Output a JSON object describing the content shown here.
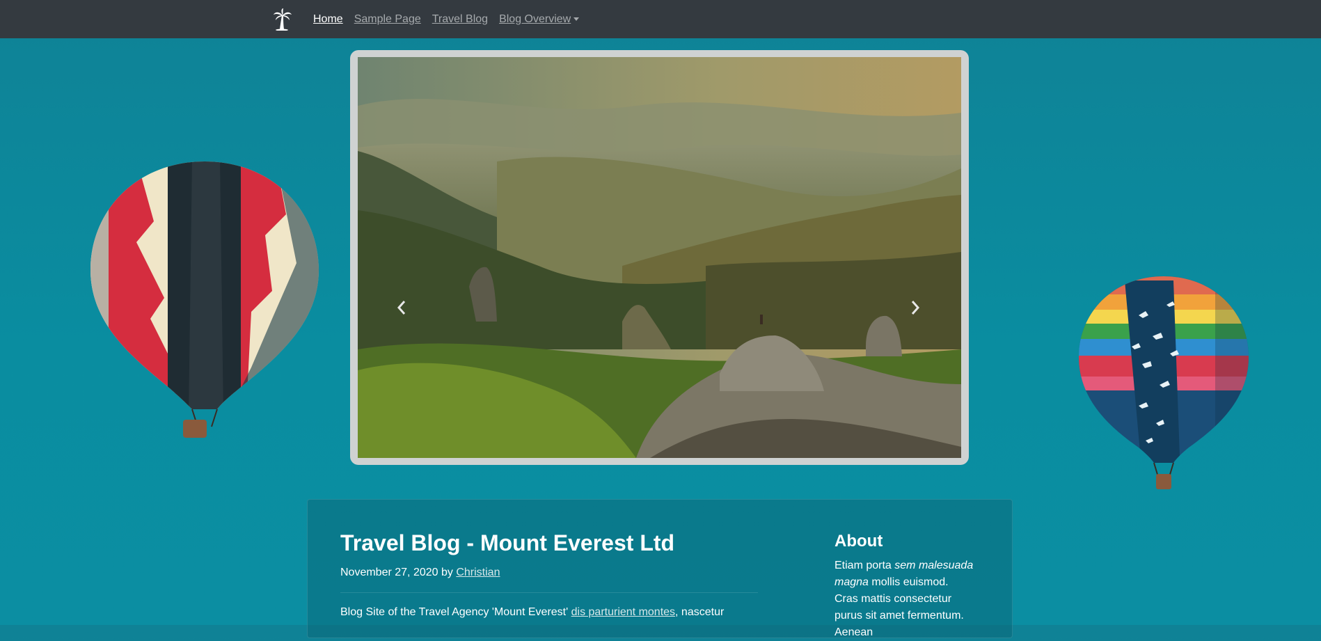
{
  "nav": {
    "brand_icon": "palm-tree-icon",
    "items": [
      {
        "label": "Home",
        "active": true
      },
      {
        "label": "Sample Page",
        "active": false
      },
      {
        "label": "Travel Blog",
        "active": false
      },
      {
        "label": "Blog Overview",
        "active": false,
        "dropdown": true
      }
    ]
  },
  "carousel": {
    "prev_icon": "chevron-left-icon",
    "next_icon": "chevron-right-icon"
  },
  "post": {
    "title": "Travel Blog - Mount Everest Ltd",
    "date": "November 27, 2020",
    "by": "by",
    "author": "Christian",
    "body_prefix": "Blog Site of the Travel Agency 'Mount Everest'",
    "body_link": "dis parturient montes",
    "body_suffix": ", nascetur"
  },
  "sidebar": {
    "about_title": "About",
    "about_text_1": "Etiam porta ",
    "about_text_em": "sem malesuada magna",
    "about_text_2": " mollis euismod. Cras mattis consectetur purus sit amet fermentum. Aenean"
  },
  "colors": {
    "navbar": "#343a40",
    "background": "#0b8ea2",
    "nav_active": "#ffffff",
    "nav_inactive": "#a6aaad"
  }
}
